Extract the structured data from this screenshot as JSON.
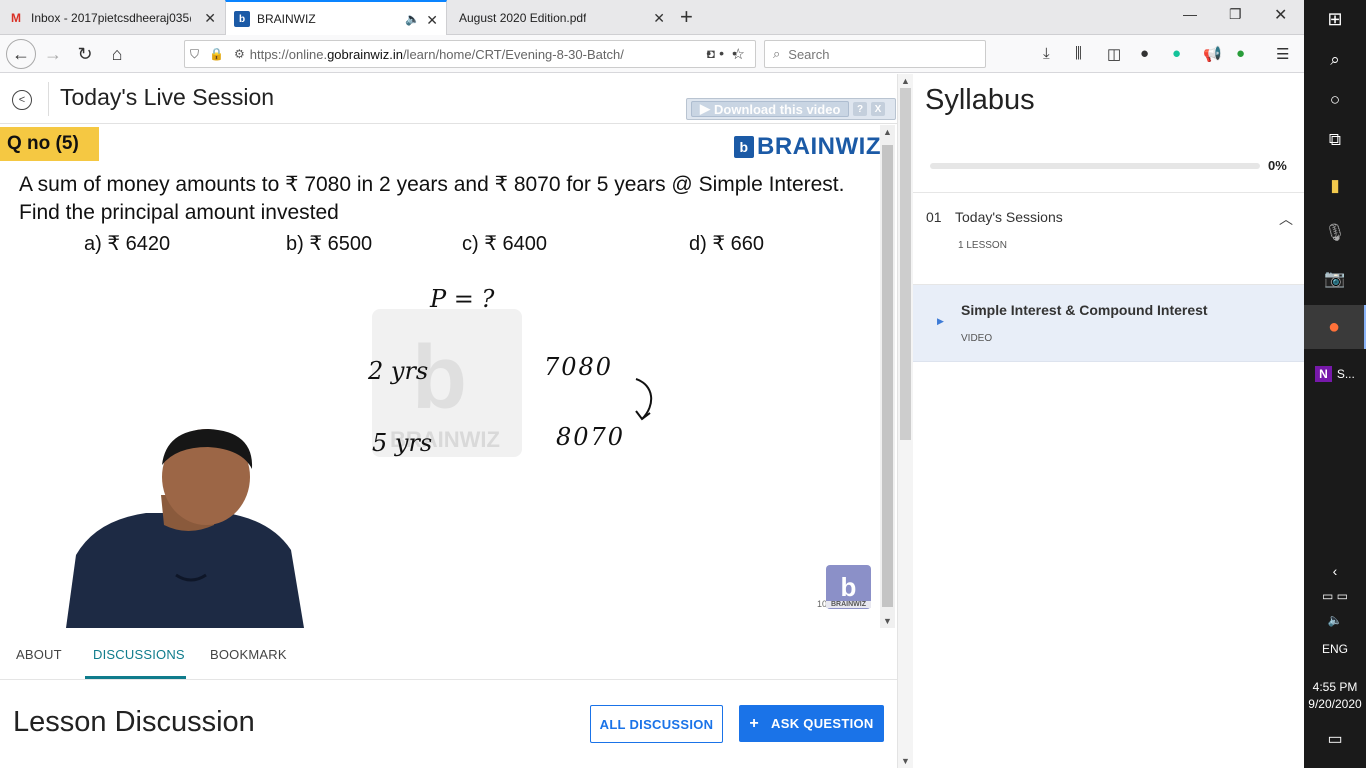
{
  "browser": {
    "tabs": [
      {
        "title": "Inbox - 2017pietcsdheeraj035@",
        "icon": "gmail-icon"
      },
      {
        "title": "BRAINWIZ",
        "icon": "brainwiz-icon",
        "active": true
      },
      {
        "title": "August 2020 Edition.pdf",
        "icon": "pdf-icon"
      }
    ],
    "url_prefix": "https://online.",
    "url_domain": "gobrainwiz.in",
    "url_path": "/learn/home/CRT/Evening-8-30-Batch/",
    "search_placeholder": "Search"
  },
  "page": {
    "header_title": "Today's Live Session",
    "download_label": "Download this video",
    "help_label": "?",
    "close_label": "X"
  },
  "video": {
    "qno": "Q no (5)",
    "brand": "BRAINWIZ",
    "question_line1": "A sum of money amounts to ₹ 7080 in 2 years and ₹ 8070 for 5 years @ Simple Interest.",
    "question_line2": "Find the principal amount invested",
    "options": [
      "a) ₹ 6420",
      "b) ₹ 6500",
      "c) ₹ 6400",
      "d) ₹ 660"
    ],
    "watermark": "BRAINWIZ",
    "handwriting": {
      "p": "P = ?",
      "yrs2": "2 yrs",
      "amt1": "7080",
      "yrs5": "5 yrs",
      "amt2": "8070"
    },
    "small_logo_label": "BRAINWIZ",
    "tiny_number": "10"
  },
  "subtabs": {
    "about": "ABOUT",
    "discussions": "DISCUSSIONS",
    "bookmark": "BOOKMARK"
  },
  "discussion": {
    "title": "Lesson Discussion",
    "all_label": "ALL DISCUSSION",
    "ask_label": "ASK QUESTION"
  },
  "syllabus": {
    "title": "Syllabus",
    "progress": 0,
    "progress_label": "0%",
    "section_number": "01",
    "section_name": "Today's Sessions",
    "section_count": "1 LESSON",
    "lesson_name": "Simple Interest & Compound Interest",
    "lesson_type": "VIDEO"
  },
  "taskbar": {
    "onenote_label": "S...",
    "language": "ENG",
    "time": "4:55 PM",
    "date": "9/20/2020"
  }
}
